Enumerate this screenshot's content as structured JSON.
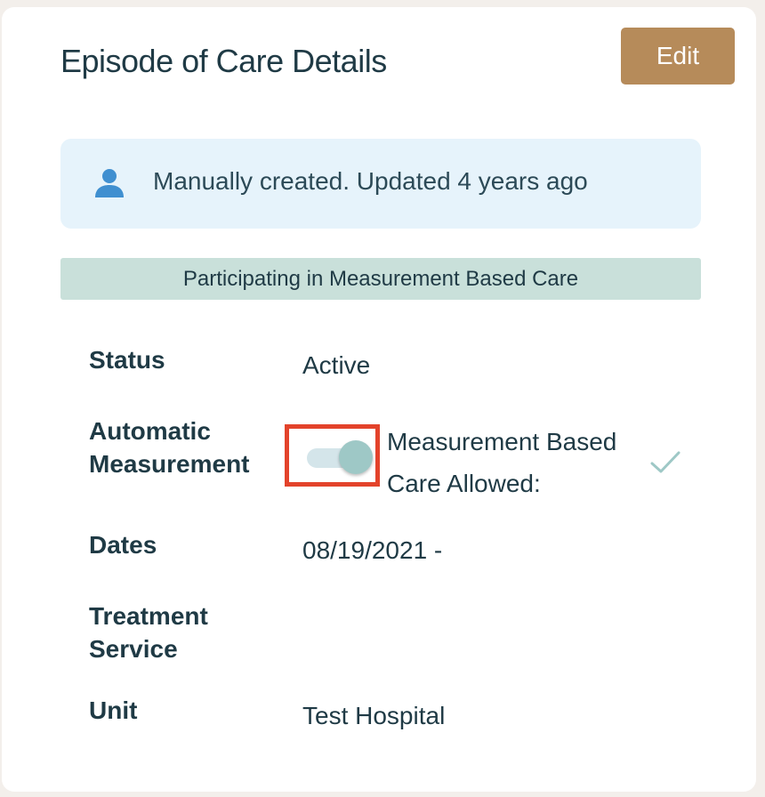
{
  "header": {
    "title": "Episode of Care Details",
    "edit_label": "Edit"
  },
  "info_banner": {
    "icon": "person-icon",
    "text": "Manually created. Updated 4 years ago"
  },
  "mbc_banner": {
    "text": "Participating in Measurement Based Care"
  },
  "details": {
    "status_label": "Status",
    "status_value": "Active",
    "automatic_label_line1": "Automatic",
    "automatic_label_line2": "Measurement",
    "automatic_toggle_on": true,
    "mbc_allowed_line1": "Measurement Based",
    "mbc_allowed_line2": "Care Allowed:",
    "mbc_allowed_icon": "check-icon",
    "dates_label": "Dates",
    "dates_value": "08/19/2021 -",
    "treatment_label_line1": "Treatment",
    "treatment_label_line2": "Service",
    "unit_label": "Unit",
    "unit_value": "Test Hospital"
  },
  "colors": {
    "accent_button": "#b68b5a",
    "info_banner_bg": "#e6f3fb",
    "mbc_banner_bg": "#c9e0da",
    "highlight_border": "#e3432b",
    "toggle_knob": "#9ec8c6"
  }
}
